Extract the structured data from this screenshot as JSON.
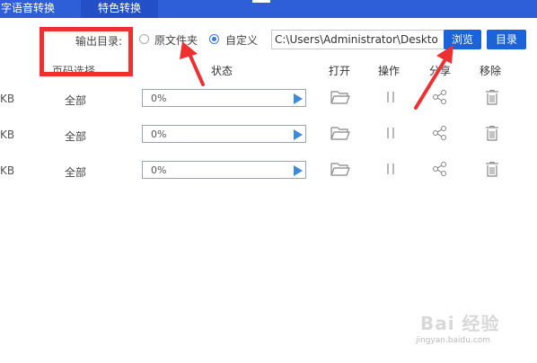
{
  "tabs": [
    {
      "label": "字语音转换"
    },
    {
      "label": "特色转换"
    }
  ],
  "toolbar": {
    "output_label": "输出目录:",
    "radio_original_label": "原文件夹",
    "radio_custom_label": "自定义",
    "selected": "custom",
    "path_value": "C:\\Users\\Administrator\\Deskto",
    "browse_label": "浏览",
    "directory_label": "目录"
  },
  "table": {
    "headers": {
      "page_select": "页码选择",
      "status": "状态",
      "open": "打开",
      "operate": "操作",
      "share": "分享",
      "remove": "移除"
    },
    "rows": [
      {
        "size": "KB",
        "pages": "全部",
        "progress_text": "0%",
        "progress": 0
      },
      {
        "size": "KB",
        "pages": "全部",
        "progress_text": "0%",
        "progress": 0
      },
      {
        "size": "KB",
        "pages": "全部",
        "progress_text": "0%",
        "progress": 0
      }
    ]
  },
  "watermark": {
    "text": "Bai 经验",
    "sub": "jingyan.baidu.com"
  },
  "colors": {
    "tab_bar": "#2f5fd8",
    "button": "#1a63d8",
    "highlight": "#ee3030",
    "play": "#3a8bde"
  },
  "icons": [
    "folder-icon",
    "pause-icon",
    "share-icon",
    "trash-icon",
    "play-icon"
  ]
}
